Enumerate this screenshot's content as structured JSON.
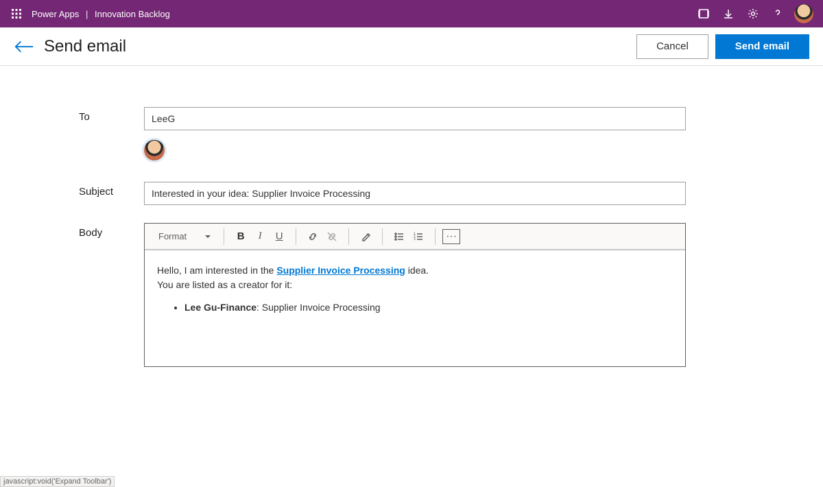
{
  "topbar": {
    "product": "Power Apps",
    "app": "Innovation Backlog"
  },
  "header": {
    "title": "Send email",
    "cancel": "Cancel",
    "send": "Send email"
  },
  "form": {
    "to_label": "To",
    "to_value": "LeeG",
    "subject_label": "Subject",
    "subject_value": "Interested in your idea: Supplier Invoice Processing",
    "body_label": "Body"
  },
  "toolbar": {
    "format": "Format",
    "bold": "B",
    "italic": "I",
    "underline": "U",
    "more": "···"
  },
  "body": {
    "line1_pre": "Hello, I am interested in the ",
    "link": "Supplier Invoice Processing",
    "line1_post": " idea.",
    "line2": "You are listed as a creator for it:",
    "bullet_strong": "Lee Gu-Finance",
    "bullet_rest": ": Supplier Invoice Processing"
  },
  "status": "javascript:void('Expand Toolbar')"
}
